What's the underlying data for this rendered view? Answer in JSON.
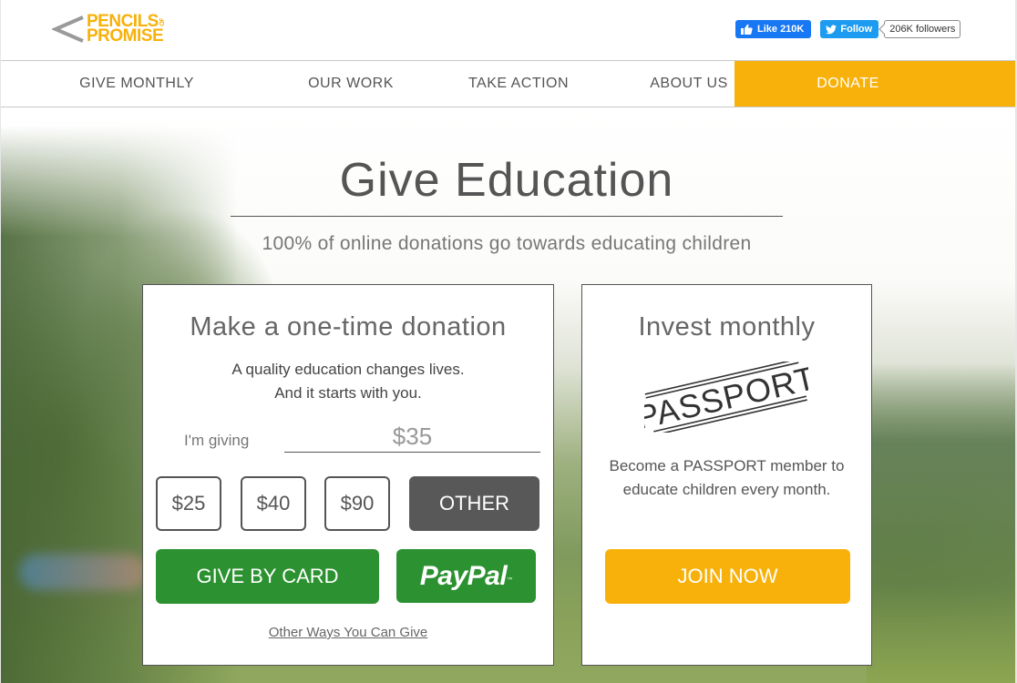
{
  "brand": {
    "logo_line1": "PENCILS",
    "logo_of": "OF",
    "logo_line2": "PROMISE",
    "accent_color": "#f8b10a",
    "green_color": "#2c9130"
  },
  "social": {
    "facebook_like_label": "Like 210K",
    "twitter_follow_label": "Follow",
    "twitter_followers": "206K followers"
  },
  "nav": {
    "items": [
      {
        "label": "GIVE MONTHLY"
      },
      {
        "label": "OUR WORK"
      },
      {
        "label": "TAKE ACTION"
      },
      {
        "label": "ABOUT US"
      }
    ],
    "donate_label": "DONATE"
  },
  "hero": {
    "title": "Give Education",
    "subtitle": "100% of online donations go towards educating children"
  },
  "one_time": {
    "title": "Make a one-time donation",
    "tagline_line1": "A quality education changes lives.",
    "tagline_line2": "And it starts with you.",
    "giving_label": "I'm giving",
    "amount_value": "$35",
    "amount_options": [
      "$25",
      "$40",
      "$90"
    ],
    "other_label": "OTHER",
    "give_by_card_label": "GIVE BY CARD",
    "paypal_label": "PayPal",
    "paypal_tm": "™",
    "other_ways_link": "Other Ways You Can Give"
  },
  "monthly": {
    "title": "Invest monthly",
    "passport_logo_text": "PASSPORT",
    "description": "Become a PASSPORT member to educate children every month.",
    "join_label": "JOIN NOW"
  }
}
